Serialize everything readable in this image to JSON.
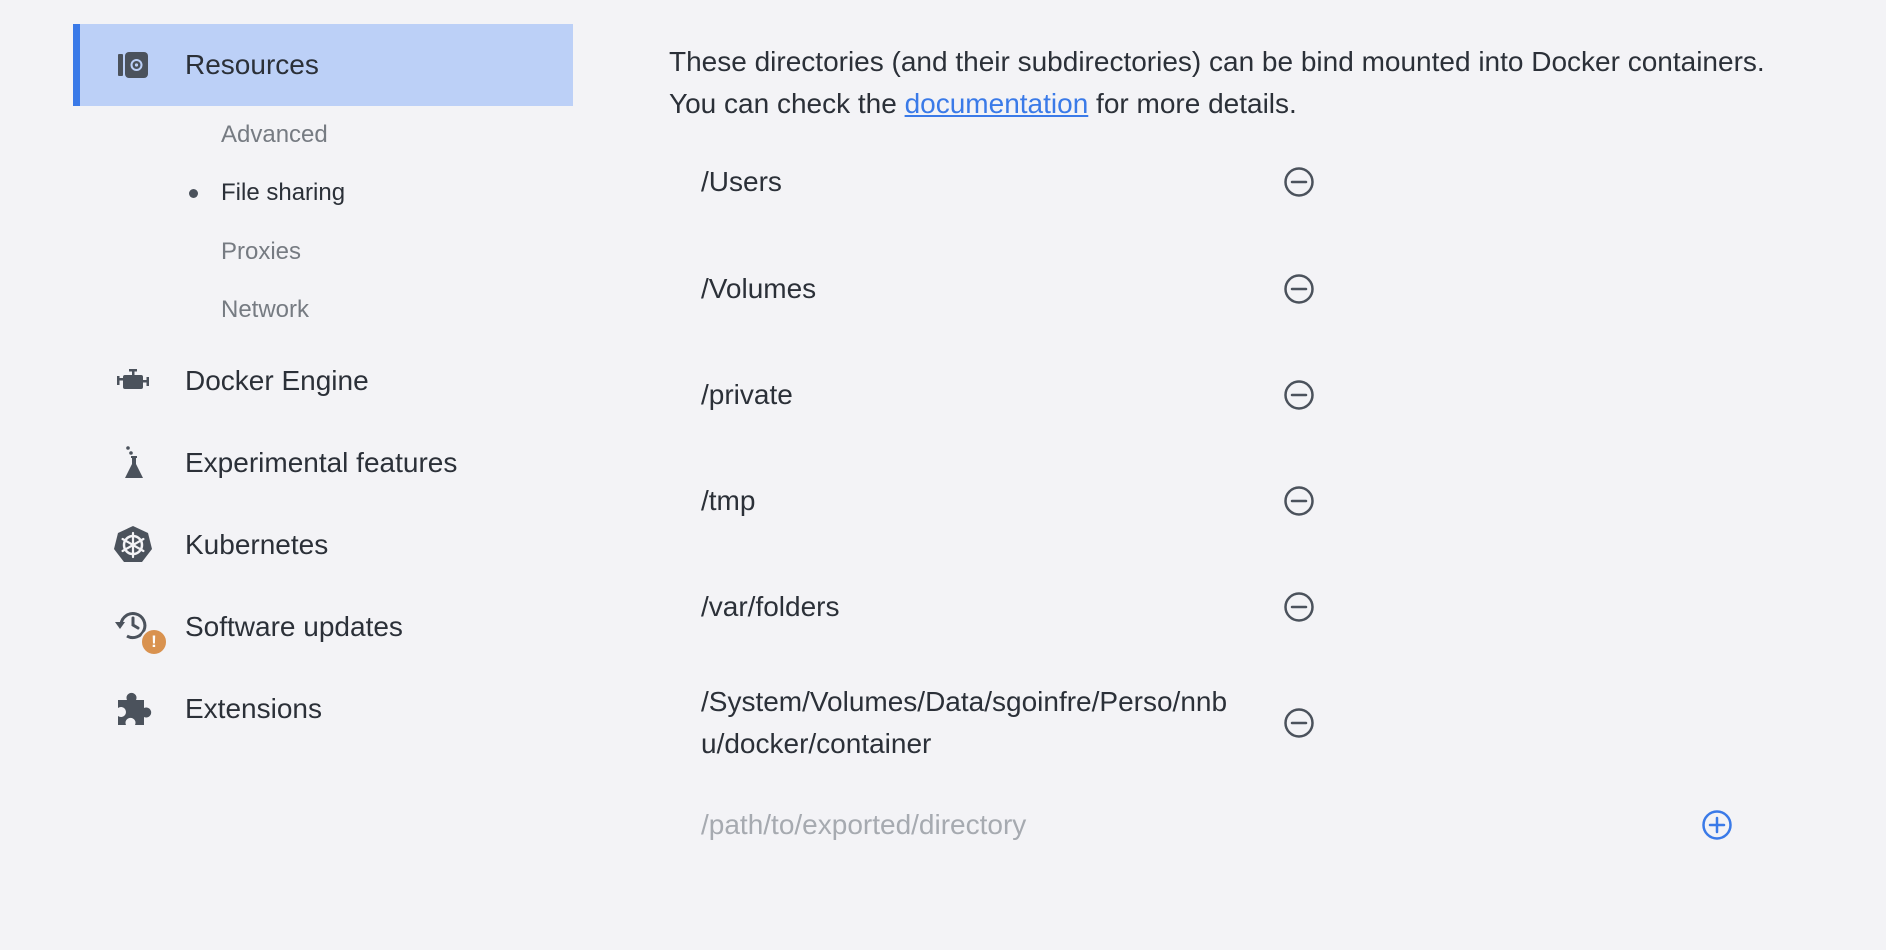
{
  "sidebar": {
    "resources_label": "Resources",
    "sub_items": [
      "Advanced",
      "File sharing",
      "Proxies",
      "Network"
    ],
    "docker_engine_label": "Docker Engine",
    "experimental_label": "Experimental features",
    "kubernetes_label": "Kubernetes",
    "software_updates_label": "Software updates",
    "extensions_label": "Extensions",
    "update_badge": "!"
  },
  "main": {
    "intro_before": "These directories (and their subdirectories) can be bind mounted into Docker containers. You can check the ",
    "intro_link": "documentation",
    "intro_after": " for more details.",
    "directories": [
      "/Users",
      "/Volumes",
      "/private",
      "/tmp",
      "/var/folders",
      "/System/Volumes/Data/sgoinfre/Perso/nnbu/docker/container"
    ],
    "new_path_placeholder": "/path/to/exported/directory",
    "new_path_value": ""
  },
  "colors": {
    "accent": "#3a7ae8",
    "active_bg": "#bcd0f7",
    "background": "#f3f3f6",
    "icon": "#4b525c",
    "badge": "#d9924f"
  },
  "icons": [
    "resources-icon",
    "engine-icon",
    "flask-icon",
    "kubernetes-helm-icon",
    "update-clock-icon",
    "warning-badge-icon",
    "puzzle-piece-icon",
    "remove-circle-icon",
    "add-circle-icon"
  ]
}
